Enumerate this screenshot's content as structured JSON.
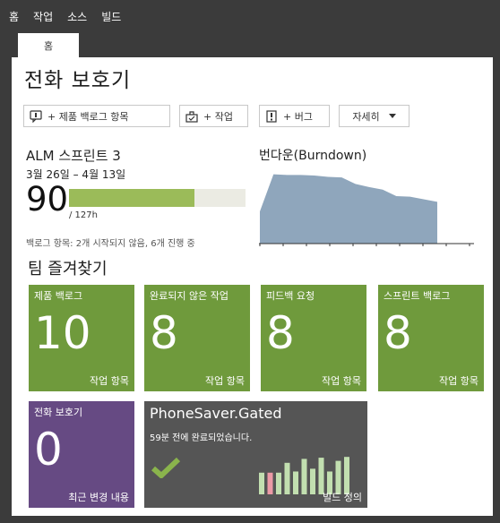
{
  "nav": {
    "items": [
      "홈",
      "작업",
      "소스",
      "빌드"
    ]
  },
  "tab": {
    "label": "홈"
  },
  "page": {
    "title": "전화 보호기"
  },
  "toolbar": {
    "new_backlog": "+ 제품 백로그 항목",
    "new_task": "+ 작업",
    "new_bug": "+ 버그",
    "more": "자세히"
  },
  "sprint": {
    "name": "ALM 스프린트 3",
    "dates": "3월 26일 – 4월 13일",
    "remaining": "90",
    "total": "/ 127h",
    "progress_fraction": 0.71,
    "backlog_note": "백로그 항목: 2개 시작되지 않음, 6개 진행 중"
  },
  "burndown": {
    "title": "번다운(Burndown)"
  },
  "chart_data": {
    "type": "area",
    "title": "번다운(Burndown)",
    "xlabel": "",
    "ylabel": "",
    "x": [
      0,
      1,
      2,
      3,
      4,
      5,
      6,
      7,
      8,
      9,
      10,
      11,
      12,
      13
    ],
    "values": [
      50,
      108,
      107,
      107,
      106,
      104,
      103,
      93,
      88,
      84,
      74,
      73,
      69,
      65
    ],
    "ylim": [
      0,
      120
    ],
    "grid": false,
    "color": "#8fa6bc"
  },
  "team": {
    "title": "팀 즐겨찾기",
    "tiles": [
      {
        "title": "제품 백로그",
        "count": "10",
        "sub": "작업 항목"
      },
      {
        "title": "완료되지 않은 작업",
        "count": "8",
        "sub": "작업 항목"
      },
      {
        "title": "피드백 요청",
        "count": "8",
        "sub": "작업 항목"
      },
      {
        "title": "스프린트 백로그",
        "count": "8",
        "sub": "작업 항목"
      }
    ],
    "changes": {
      "title": "전화 보호기",
      "count": "0",
      "sub": "최근 변경 내용"
    },
    "build": {
      "name": "PhoneSaver.Gated",
      "status": "59분 전에 완료되었습니다.",
      "sub": "빌드 정의",
      "history": [
        {
          "value": 0.55,
          "state": "succeeded"
        },
        {
          "value": 0.55,
          "state": "failed"
        },
        {
          "value": 0.55,
          "state": "succeeded"
        },
        {
          "value": 0.8,
          "state": "succeeded"
        },
        {
          "value": 0.58,
          "state": "succeeded"
        },
        {
          "value": 0.9,
          "state": "succeeded"
        },
        {
          "value": 0.65,
          "state": "succeeded"
        },
        {
          "value": 0.93,
          "state": "succeeded"
        },
        {
          "value": 0.58,
          "state": "succeeded"
        },
        {
          "value": 0.85,
          "state": "succeeded"
        },
        {
          "value": 0.95,
          "state": "succeeded"
        }
      ],
      "colors": {
        "succeeded": "#c2dfb0",
        "failed": "#ec9aa6",
        "check": "#8ab44c"
      }
    }
  }
}
